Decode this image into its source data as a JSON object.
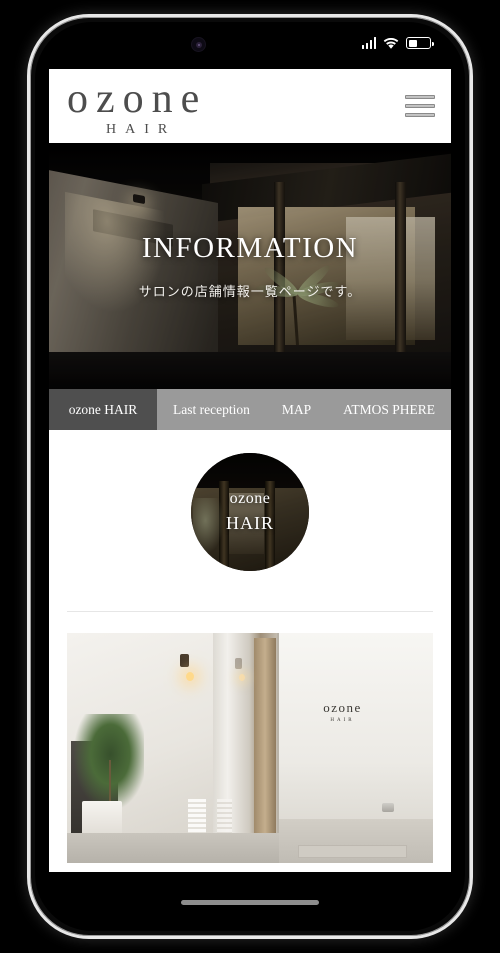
{
  "status_bar": {
    "signal_icon": "signal-bars-icon",
    "wifi_icon": "wifi-icon",
    "battery_icon": "battery-icon",
    "battery_level_percent": 42
  },
  "site_header": {
    "logo_primary": "ozone",
    "logo_secondary": "HAIR",
    "menu_icon": "hamburger-menu-icon"
  },
  "hero": {
    "title": "INFORMATION",
    "subtitle": "サロンの店舗情報一覧ページです。",
    "image_description": "night-exterior-of-salon-building"
  },
  "tabs": [
    {
      "label": "ozone HAIR",
      "active": true
    },
    {
      "label": "Last reception",
      "active": false
    },
    {
      "label": "MAP",
      "active": false
    },
    {
      "label": "ATMOS PHERE",
      "active": false
    }
  ],
  "content": {
    "avatar": {
      "line1": "ozone",
      "line2": "HAIR",
      "image_description": "circular-thumbnail-of-salon-interior"
    },
    "interior_photo": {
      "sign_main": "ozone",
      "sign_sub": "HAIR",
      "image_description": "salon-entrance-white-wall-plant-glass-door"
    }
  },
  "colors": {
    "tab_active_bg": "#4f4f4f",
    "tab_bar_bg": "#9a9a9a",
    "logo_text": "#4d4d4d",
    "divider": "#e6e6e6",
    "page_bg": "#ffffff"
  },
  "home_indicator": "home-indicator-bar"
}
